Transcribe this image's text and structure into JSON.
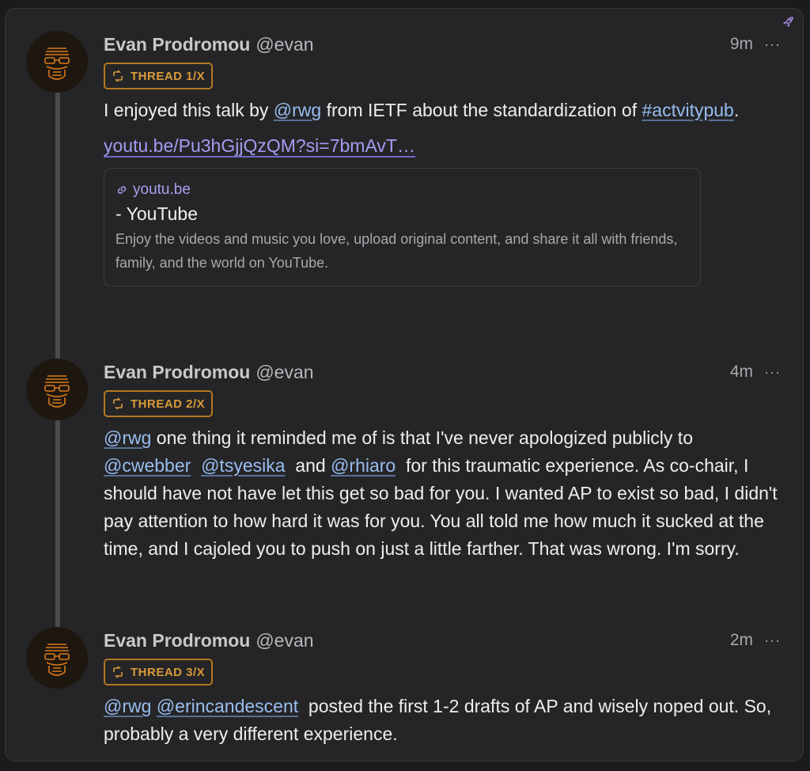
{
  "colors": {
    "background": "#252527",
    "badge": "#d99a39",
    "mention": "#98bdf0",
    "link": "#a39bf2",
    "thread_line": "#4a4a4d"
  },
  "icons": {
    "corner": "rocket-icon",
    "badge": "thread-icon",
    "link_preview": "link-icon",
    "menu": "more-icon"
  },
  "posts": [
    {
      "author_name": "Evan Prodromou",
      "author_handle": "@evan",
      "time": "9m",
      "more": "···",
      "badge": "THREAD 1/X",
      "text_parts": [
        "I enjoyed this talk by ",
        "@rwg",
        " from IETF about the standardization of ",
        "#actvitypub",
        "."
      ],
      "link_text": "youtu.be/Pu3hGjjQzQM?si=7bmAvT…",
      "preview": {
        "domain": "youtu.be",
        "title": "- YouTube",
        "description": "Enjoy the videos and music you love, upload original content, and share it all with friends, family, and the world on YouTube."
      }
    },
    {
      "author_name": "Evan Prodromou",
      "author_handle": "@evan",
      "time": "4m",
      "more": "···",
      "badge": "THREAD 2/X",
      "text_parts": [
        "@rwg",
        " one thing it reminded me of is that I've never apologized publicly to ",
        "@cwebber",
        "@tsyesika",
        " and ",
        "@rhiaro",
        " for this traumatic experience. As co-chair, I should have not have let this get so bad for you. I wanted AP to exist so bad, I didn't pay attention to how hard it was for you. You all told me how much it sucked at the time, and I cajoled you to push on just a little farther. That was wrong. I'm sorry."
      ]
    },
    {
      "author_name": "Evan Prodromou",
      "author_handle": "@evan",
      "time": "2m",
      "more": "···",
      "badge": "THREAD 3/X",
      "text_parts": [
        "@rwg",
        "@erincandescent",
        " posted the first 1-2 drafts of AP and wisely noped out. So, probably a very different experience."
      ]
    }
  ]
}
